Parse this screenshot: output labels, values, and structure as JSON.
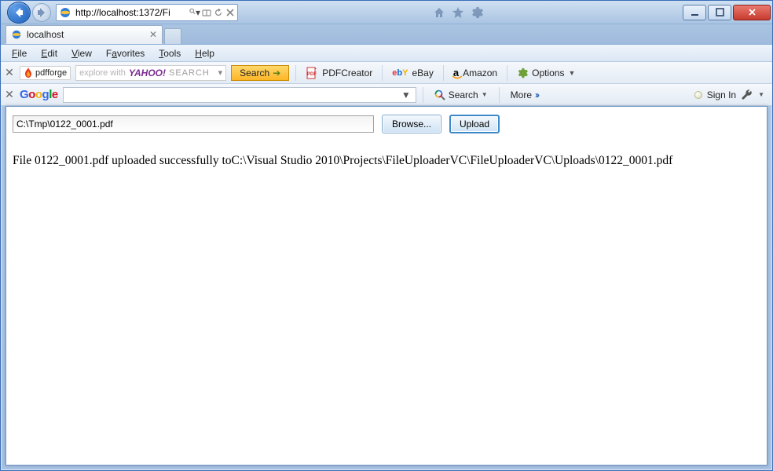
{
  "titlebar": {
    "url": "http://localhost:1372/Fi"
  },
  "tab": {
    "title": "localhost"
  },
  "menu": {
    "file": "File",
    "edit": "Edit",
    "view": "View",
    "favorites": "Favorites",
    "tools": "Tools",
    "help": "Help"
  },
  "toolbar_pdfforge": {
    "brand": "pdfforge",
    "yahoo_placeholder": "explore with",
    "yahoo_search_label": "SEARCH",
    "search_btn": "Search",
    "pdfcreator": "PDFCreator",
    "ebay": "eBay",
    "amazon": "Amazon",
    "options": "Options"
  },
  "toolbar_google": {
    "search_btn": "Search",
    "more": "More",
    "signin": "Sign In"
  },
  "page": {
    "file_path_value": "C:\\Tmp\\0122_0001.pdf",
    "browse_btn": "Browse...",
    "upload_btn": "Upload",
    "message": "File 0122_0001.pdf uploaded successfully toC:\\Visual Studio 2010\\Projects\\FileUploaderVC\\FileUploaderVC\\Uploads\\0122_0001.pdf"
  }
}
